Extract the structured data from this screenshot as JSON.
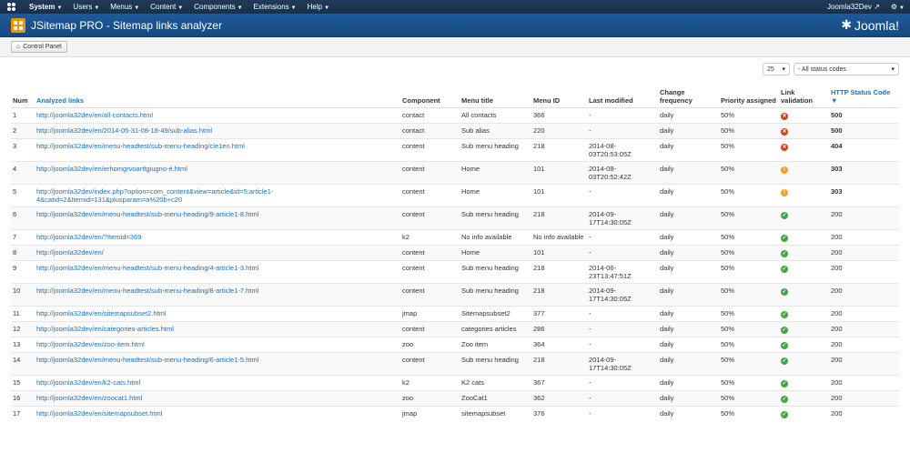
{
  "nav": {
    "items": [
      "System",
      "Users",
      "Menus",
      "Content",
      "Components",
      "Extensions",
      "Help"
    ],
    "user": "Joomla32Dev"
  },
  "header": {
    "title": "JSitemap PRO - Sitemap links analyzer",
    "brand": "Joomla!"
  },
  "toolbar": {
    "control_panel": "Control Panel"
  },
  "filters": {
    "limit": "25",
    "status": "- All status codes"
  },
  "table": {
    "headers": {
      "num": "Num",
      "link": "Analyzed links",
      "component": "Component",
      "menu_title": "Menu title",
      "menu_id": "Menu ID",
      "last_modified": "Last modified",
      "change_frequency": "Change frequency",
      "priority": "Priority assigned",
      "validation": "Link validation",
      "http_status": "HTTP Status Code"
    },
    "rows": [
      {
        "num": "1",
        "link": "http://joomla32dev/en/all-contacts.html",
        "component": "contact",
        "menu_title": "All contacts",
        "menu_id": "366",
        "last_modified": "-",
        "freq": "daily",
        "priority": "50%",
        "status": "error",
        "code": "500"
      },
      {
        "num": "2",
        "link": "http://joomla32dev/en/2014-05-31-08-18-49/sub-alias.html",
        "component": "contact",
        "menu_title": "Sub alias",
        "menu_id": "220",
        "last_modified": "-",
        "freq": "daily",
        "priority": "50%",
        "status": "error",
        "code": "500"
      },
      {
        "num": "3",
        "link": "http://joomla32dev/en/menu-headtest/sub-menu-heading/cle1en.html",
        "component": "content",
        "menu_title": "Sub menu heading",
        "menu_id": "218",
        "last_modified": "2014-08-03T20:53:05Z",
        "freq": "daily",
        "priority": "50%",
        "status": "error",
        "code": "404"
      },
      {
        "num": "4",
        "link": "http://joomla32dev/en/erhomgrvoarttgiugno-è.html",
        "component": "content",
        "menu_title": "Home",
        "menu_id": "101",
        "last_modified": "2014-08-03T20:52:42Z",
        "freq": "daily",
        "priority": "50%",
        "status": "warn",
        "code": "303"
      },
      {
        "num": "5",
        "link": "http://joomla32dev/index.php?option=com_content&view=article&id=5:article1-4&catid=2&Itemid=131&plusparam=a%20b+c20",
        "component": "content",
        "menu_title": "Home",
        "menu_id": "101",
        "last_modified": "-",
        "freq": "daily",
        "priority": "50%",
        "status": "warn",
        "code": "303"
      },
      {
        "num": "6",
        "link": "http://joomla32dev/en/menu-headtest/sub-menu-heading/9-article1-8.html",
        "component": "content",
        "menu_title": "Sub menu heading",
        "menu_id": "218",
        "last_modified": "2014-09-17T14:30:05Z",
        "freq": "daily",
        "priority": "50%",
        "status": "ok",
        "code": "200"
      },
      {
        "num": "7",
        "link": "http://joomla32dev/en/?Itemid=369",
        "component": "k2",
        "menu_title": "No info available",
        "menu_id": "No info available",
        "last_modified": "-",
        "freq": "daily",
        "priority": "50%",
        "status": "ok",
        "code": "200"
      },
      {
        "num": "8",
        "link": "http://joomla32dev/en/",
        "component": "content",
        "menu_title": "Home",
        "menu_id": "101",
        "last_modified": "-",
        "freq": "daily",
        "priority": "50%",
        "status": "ok",
        "code": "200"
      },
      {
        "num": "9",
        "link": "http://joomla32dev/en/menu-headtest/sub-menu-heading/4-article1-3.html",
        "component": "content",
        "menu_title": "Sub menu heading",
        "menu_id": "218",
        "last_modified": "2014-06-23T13:47:51Z",
        "freq": "daily",
        "priority": "50%",
        "status": "ok",
        "code": "200"
      },
      {
        "num": "10",
        "link": "http://joomla32dev/en/menu-headtest/sub-menu-heading/8-article1-7.html",
        "component": "content",
        "menu_title": "Sub menu heading",
        "menu_id": "218",
        "last_modified": "2014-09-17T14:30:05Z",
        "freq": "daily",
        "priority": "50%",
        "status": "ok",
        "code": "200"
      },
      {
        "num": "11",
        "link": "http://joomla32dev/en/sitemapsubset2.html",
        "component": "jmap",
        "menu_title": "Sitemapsubset2",
        "menu_id": "377",
        "last_modified": "-",
        "freq": "daily",
        "priority": "50%",
        "status": "ok",
        "code": "200"
      },
      {
        "num": "12",
        "link": "http://joomla32dev/en/categories-articles.html",
        "component": "content",
        "menu_title": "categories articles",
        "menu_id": "286",
        "last_modified": "-",
        "freq": "daily",
        "priority": "50%",
        "status": "ok",
        "code": "200"
      },
      {
        "num": "13",
        "link": "http://joomla32dev/en/zoo-item.html",
        "component": "zoo",
        "menu_title": "Zoo item",
        "menu_id": "364",
        "last_modified": "-",
        "freq": "daily",
        "priority": "50%",
        "status": "ok",
        "code": "200"
      },
      {
        "num": "14",
        "link": "http://joomla32dev/en/menu-headtest/sub-menu-heading/6-article1-5.html",
        "component": "content",
        "menu_title": "Sub menu heading",
        "menu_id": "218",
        "last_modified": "2014-09-17T14:30:05Z",
        "freq": "daily",
        "priority": "50%",
        "status": "ok",
        "code": "200"
      },
      {
        "num": "15",
        "link": "http://joomla32dev/en/k2-cats.html",
        "component": "k2",
        "menu_title": "K2 cats",
        "menu_id": "367",
        "last_modified": "-",
        "freq": "daily",
        "priority": "50%",
        "status": "ok",
        "code": "200"
      },
      {
        "num": "16",
        "link": "http://joomla32dev/en/zoocat1.html",
        "component": "zoo",
        "menu_title": "ZooCat1",
        "menu_id": "362",
        "last_modified": "-",
        "freq": "daily",
        "priority": "50%",
        "status": "ok",
        "code": "200"
      },
      {
        "num": "17",
        "link": "http://joomla32dev/en/sitemapsubset.html",
        "component": "jmap",
        "menu_title": "sitemapsubset",
        "menu_id": "376",
        "last_modified": "-",
        "freq": "daily",
        "priority": "50%",
        "status": "ok",
        "code": "200"
      }
    ]
  }
}
